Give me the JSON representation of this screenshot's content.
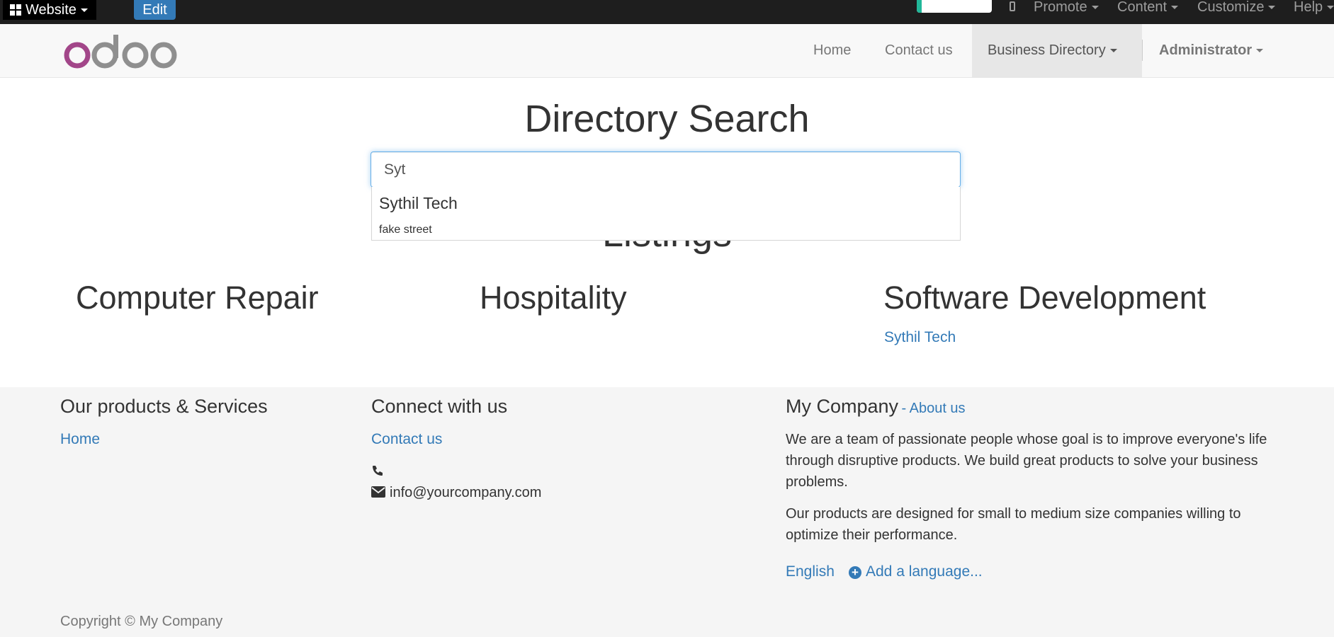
{
  "adminbar": {
    "website_label": "Website",
    "edit_label": "Edit",
    "menus": [
      "Promote",
      "Content",
      "Customize",
      "Help"
    ]
  },
  "navbar": {
    "logo_text": "odoo",
    "items": [
      {
        "label": "Home"
      },
      {
        "label": "Contact us"
      },
      {
        "label": "Business Directory"
      }
    ],
    "user": "Administrator"
  },
  "main": {
    "title": "Directory Search",
    "search_value": "Syt",
    "suggestion": {
      "name": "Sythil Tech",
      "address": "fake street"
    },
    "listings_title": "Listings",
    "categories": [
      {
        "name": "Computer Repair",
        "items": []
      },
      {
        "name": "Hospitality",
        "items": []
      },
      {
        "name": "Software Development",
        "items": [
          "Sythil Tech"
        ]
      }
    ]
  },
  "footer": {
    "col1": {
      "heading": "Our products & Services",
      "link": "Home"
    },
    "col2": {
      "heading": "Connect with us",
      "link": "Contact us",
      "email": "info@yourcompany.com"
    },
    "col3": {
      "heading": "My Company",
      "about_link": "- About us",
      "para1": "We are a team of passionate people whose goal is to improve everyone's life through disruptive products. We build great products to solve your business problems.",
      "para2": "Our products are designed for small to medium size companies willing to optimize their performance.",
      "lang_current": "English",
      "lang_add": "Add a language..."
    },
    "copyright": "Copyright © My Company"
  },
  "colors": {
    "adminbar_bg": "#1e1e1e",
    "edit_button": "#337ab7",
    "link": "#337ab7",
    "logo_o": "#a24689",
    "logo_grey": "#8f8f8f",
    "toggle_accent": "#21b799"
  }
}
